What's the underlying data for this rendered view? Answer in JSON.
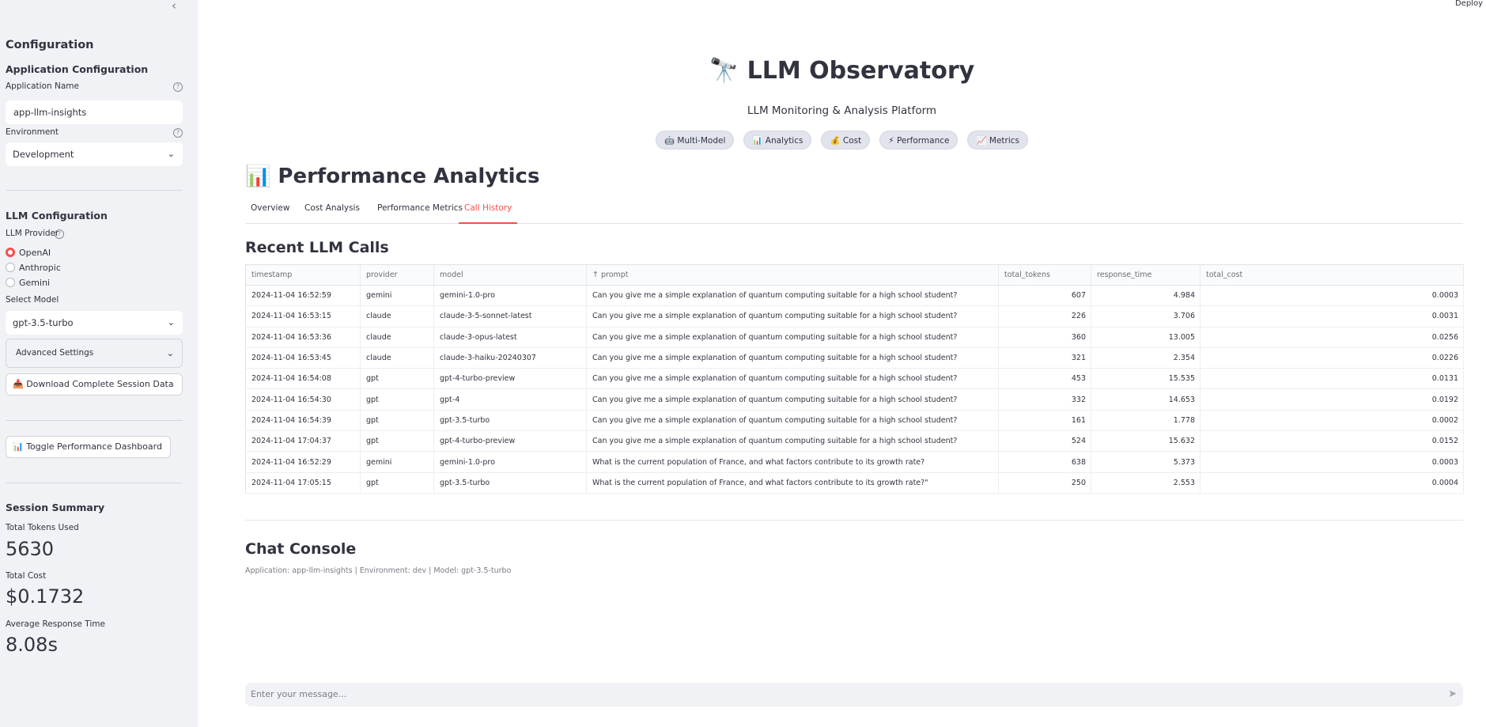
{
  "header": {
    "deploy_label": "Deploy"
  },
  "sidebar": {
    "collapse_glyph": "‹",
    "title": "Configuration",
    "app_config": {
      "heading": "Application Configuration",
      "app_name_label": "Application Name",
      "app_name_value": "app-llm-insights",
      "environment_label": "Environment",
      "environment_value": "Development"
    },
    "llm_config": {
      "heading": "LLM Configuration",
      "provider_label": "LLM Provider",
      "providers": [
        "OpenAI",
        "Anthropic",
        "Gemini"
      ],
      "selected_provider": "OpenAI",
      "model_label": "Select Model",
      "model_value": "gpt-3.5-turbo",
      "advanced_label": "Advanced Settings",
      "download_label": "📥 Download Complete Session Data"
    },
    "toggle_dashboard_label": "📊 Toggle Performance Dashboard",
    "summary": {
      "heading": "Session Summary",
      "tokens_label": "Total Tokens Used",
      "tokens_value": "5630",
      "cost_label": "Total Cost",
      "cost_value": "$0.1732",
      "response_label": "Average Response Time",
      "response_value": "8.08s"
    }
  },
  "main": {
    "title": "🔭 LLM Observatory",
    "subtitle": "LLM Monitoring & Analysis Platform",
    "chips": [
      "🤖 Multi-Model",
      "📊 Analytics",
      "💰 Cost",
      "⚡ Performance",
      "📈 Metrics"
    ],
    "section_title": "📊 Performance Analytics",
    "tabs": [
      "Overview",
      "Cost Analysis",
      "Performance Metrics",
      "Call History"
    ],
    "active_tab": "Call History",
    "table_title": "Recent LLM Calls",
    "table": {
      "columns": [
        "timestamp",
        "provider",
        "model",
        "↑ prompt",
        "total_tokens",
        "response_time",
        "total_cost"
      ],
      "rows": [
        [
          "2024-11-04 16:52:59",
          "gemini",
          "gemini-1.0-pro",
          "Can you give me a simple explanation of quantum computing suitable for a high school student?",
          "607",
          "4.984",
          "0.0003"
        ],
        [
          "2024-11-04 16:53:15",
          "claude",
          "claude-3-5-sonnet-latest",
          "Can you give me a simple explanation of quantum computing suitable for a high school student?",
          "226",
          "3.706",
          "0.0031"
        ],
        [
          "2024-11-04 16:53:36",
          "claude",
          "claude-3-opus-latest",
          "Can you give me a simple explanation of quantum computing suitable for a high school student?",
          "360",
          "13.005",
          "0.0256"
        ],
        [
          "2024-11-04 16:53:45",
          "claude",
          "claude-3-haiku-20240307",
          "Can you give me a simple explanation of quantum computing suitable for a high school student?",
          "321",
          "2.354",
          "0.0226"
        ],
        [
          "2024-11-04 16:54:08",
          "gpt",
          "gpt-4-turbo-preview",
          "Can you give me a simple explanation of quantum computing suitable for a high school student?",
          "453",
          "15.535",
          "0.0131"
        ],
        [
          "2024-11-04 16:54:30",
          "gpt",
          "gpt-4",
          "Can you give me a simple explanation of quantum computing suitable for a high school student?",
          "332",
          "14.653",
          "0.0192"
        ],
        [
          "2024-11-04 16:54:39",
          "gpt",
          "gpt-3.5-turbo",
          "Can you give me a simple explanation of quantum computing suitable for a high school student?",
          "161",
          "1.778",
          "0.0002"
        ],
        [
          "2024-11-04 17:04:37",
          "gpt",
          "gpt-4-turbo-preview",
          "Can you give me a simple explanation of quantum computing suitable for a high school student?",
          "524",
          "15.632",
          "0.0152"
        ],
        [
          "2024-11-04 16:52:29",
          "gemini",
          "gemini-1.0-pro",
          "What is the current population of France, and what factors contribute to its growth rate?",
          "638",
          "5.373",
          "0.0003"
        ],
        [
          "2024-11-04 17:05:15",
          "gpt",
          "gpt-3.5-turbo",
          "What is the current population of France, and what factors contribute to its growth rate?\"",
          "250",
          "2.553",
          "0.0004"
        ]
      ]
    },
    "chat": {
      "title": "Chat Console",
      "caption": "Application: app-llm-insights | Environment: dev | Model: gpt-3.5-turbo",
      "placeholder": "Enter your message...",
      "send_icon": "send-icon"
    }
  },
  "colors": {
    "accent": "#ff4b4b",
    "sidebar_bg": "#f0f2f6",
    "text": "#31333f"
  }
}
